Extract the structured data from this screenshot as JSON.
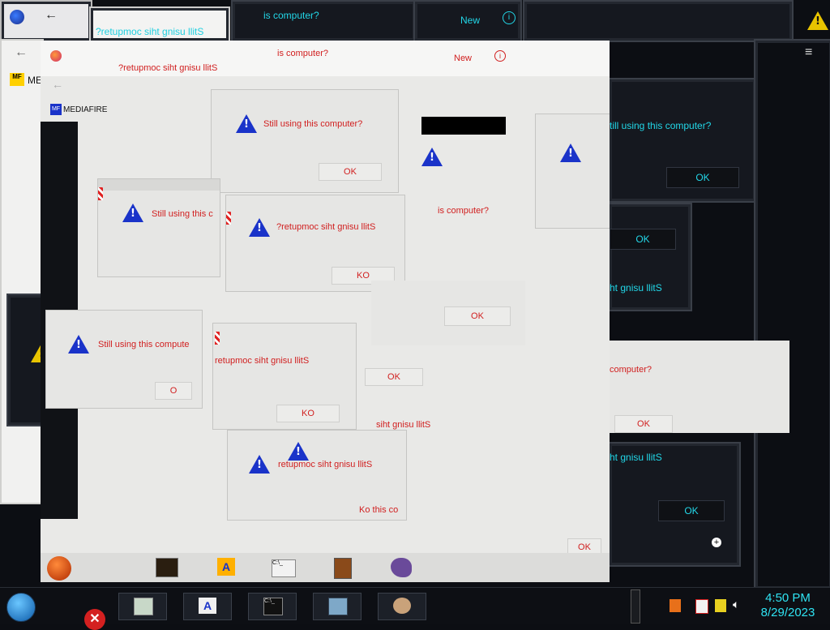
{
  "dialog": {
    "message": "Still using this computer?",
    "message_mirrored": "?retupmoc siht gnisu llitS",
    "message_fragment1": "Still using this compute",
    "message_fragment2": "is computer?",
    "message_fragment3": "Still using this c",
    "message_fragment4": "computer?",
    "message_fragment5": "siht gnisu llitS",
    "message_fragment6": "ht gnisu llitS",
    "message_fragment7": "tis computer?",
    "message_fragment8": "till using this computer?",
    "message_fragment9": "retupmoc siht gnisu llitS",
    "message_fragment10": "Ko this co",
    "ok_label": "OK",
    "ok_mirrored": "KO",
    "ok_fragment": "O"
  },
  "browser": {
    "new_tab": "New",
    "back": "←",
    "site_name": "MEDIAFIRE",
    "site_abbrev": "ME",
    "mf_logo": "MF"
  },
  "taskbar": {
    "time": "4:50 PM",
    "date": "8/29/2023",
    "cmd_text": "C:\\_"
  },
  "colors": {
    "cyan": "#10d8e8",
    "red_text": "#d12020",
    "warn_blue": "#1a33c9",
    "warn_yellow": "#e8c400"
  }
}
